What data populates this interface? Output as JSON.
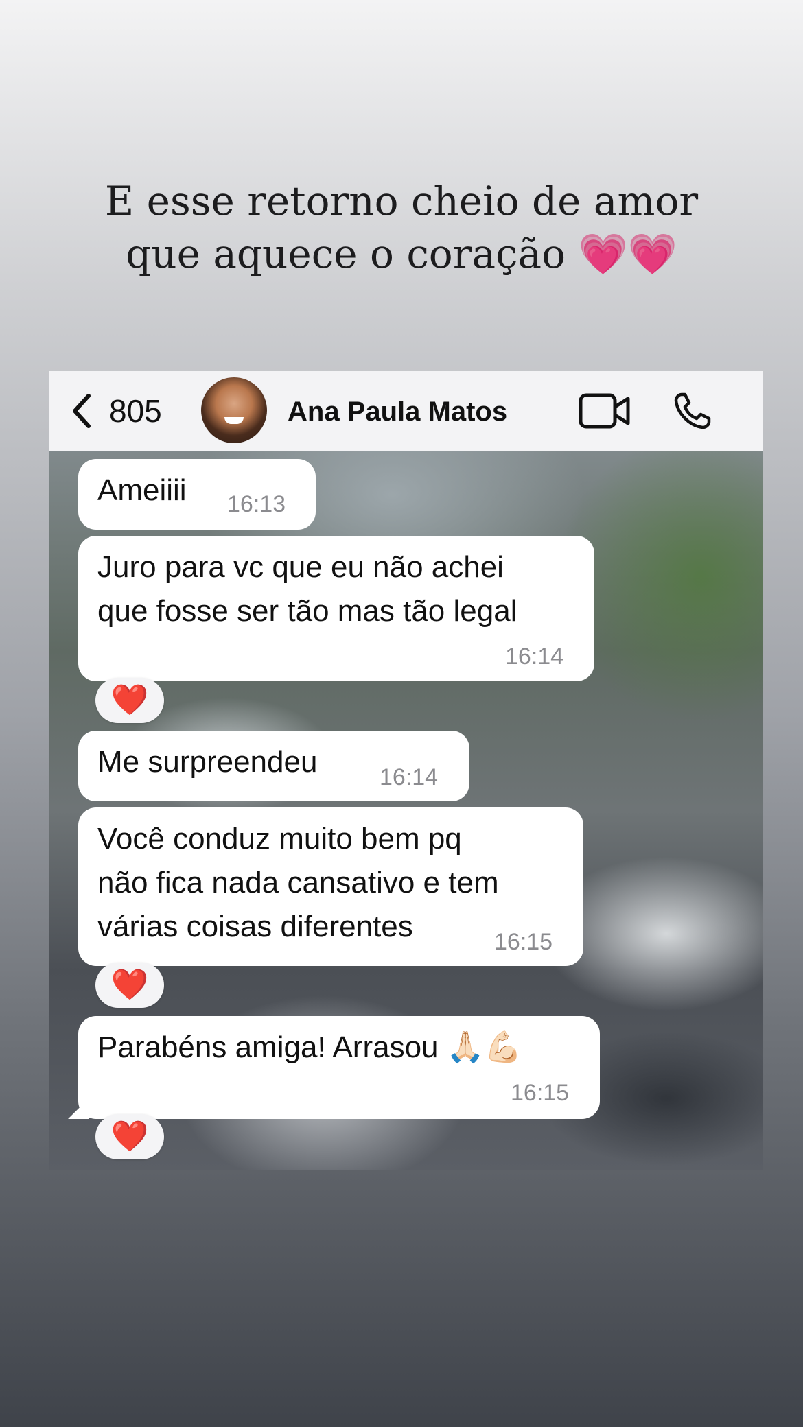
{
  "caption": {
    "line1": "E esse retorno cheio de amor",
    "line2": "que aquece o coração ",
    "hearts": "💗💗"
  },
  "header": {
    "back_count": "805",
    "contact_name": "Ana Paula Matos",
    "icons": {
      "back": "chevron-left-icon",
      "video": "video-camera-icon",
      "call": "phone-icon"
    }
  },
  "messages": [
    {
      "lines": [
        "Ameiiii"
      ],
      "time": "16:13",
      "reaction": null
    },
    {
      "lines": [
        "Juro para vc que eu não achei",
        "que fosse ser tão mas tão legal"
      ],
      "time": "16:14",
      "reaction": "❤️"
    },
    {
      "lines": [
        "Me surpreendeu"
      ],
      "time": "16:14",
      "reaction": null
    },
    {
      "lines": [
        "Você conduz muito bem pq",
        "não fica nada cansativo e tem",
        "várias coisas diferentes"
      ],
      "time": "16:15",
      "reaction": "❤️"
    },
    {
      "lines": [
        "Parabéns amiga! Arrasou 🙏🏻💪🏻"
      ],
      "time": "16:15",
      "reaction": "❤️"
    }
  ],
  "colors": {
    "bubble": "#ffffff",
    "header": "#f3f3f5",
    "time": "#8b8b8f",
    "heart": "#ff2d2d"
  }
}
